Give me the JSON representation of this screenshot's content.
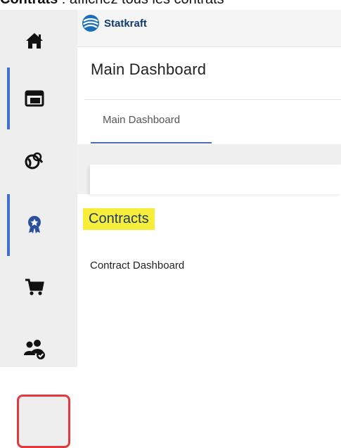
{
  "caption": {
    "bold": "Contrats",
    "rest": " : affichez tous les contrats"
  },
  "rail": {
    "items": [
      {
        "name": "home",
        "icon": "home-icon"
      },
      {
        "name": "dashboard",
        "icon": "dashboard-layout-icon"
      },
      {
        "name": "global-search",
        "icon": "globe-search-icon"
      },
      {
        "name": "contracts",
        "icon": "award-badge-icon"
      },
      {
        "name": "cart",
        "icon": "shopping-cart-icon"
      },
      {
        "name": "users",
        "icon": "users-group-icon"
      }
    ],
    "accent_color": "#3f6fd1",
    "highlight_color": "#e0393e"
  },
  "brand": {
    "name": "Statkraft",
    "color": "#123a6b"
  },
  "dashboard": {
    "title": "Main Dashboard",
    "tab_label": "Main Dashboard"
  },
  "contracts": {
    "heading": "Contracts",
    "highlight_color": "#f7ee3c",
    "link": "Contract Dashboard"
  }
}
